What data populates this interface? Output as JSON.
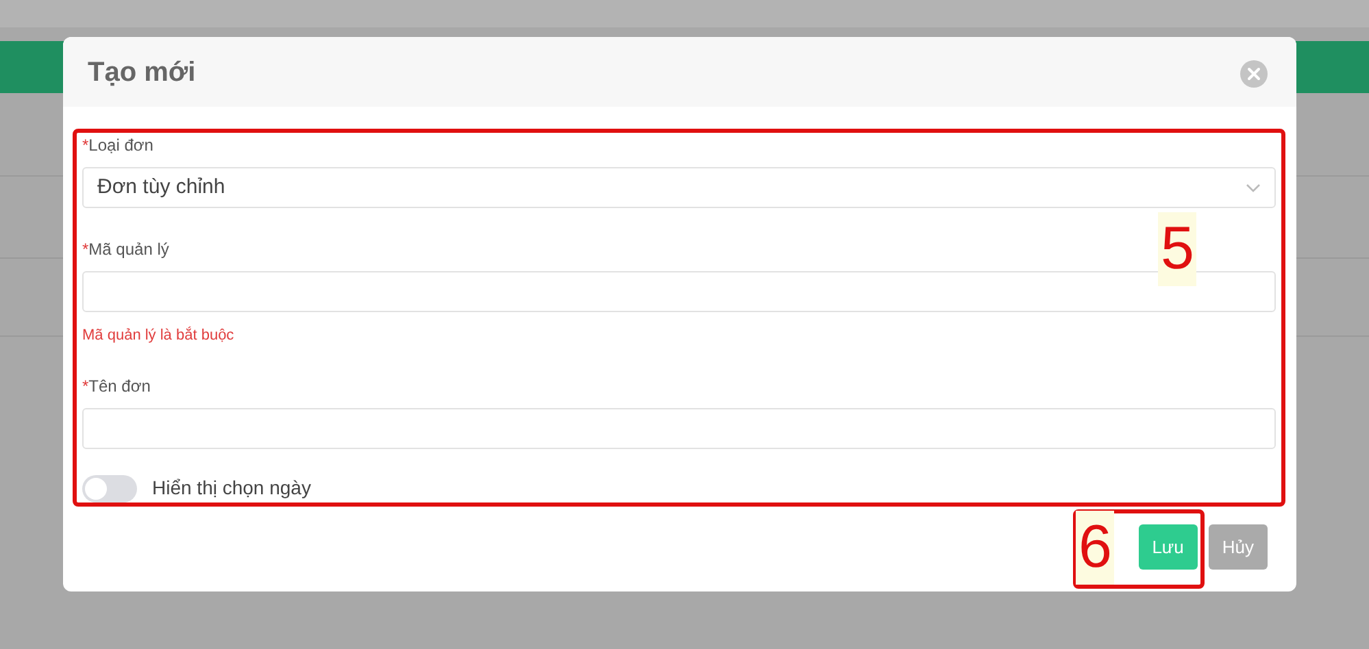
{
  "modal": {
    "title": "Tạo mới",
    "fields": [
      {
        "kind": "select",
        "marker": "*",
        "label": "Loại đơn",
        "value": "Đơn tùy chỉnh"
      },
      {
        "kind": "text",
        "marker": "*",
        "label": "Mã quản lý",
        "error": "Mã quản lý là bắt buộc"
      },
      {
        "kind": "text",
        "marker": "*",
        "label": "Tên đơn"
      },
      {
        "kind": "switch",
        "label": "Hiển thị chọn ngày",
        "on": false
      }
    ],
    "buttons": [
      {
        "label": "Lưu",
        "kind": "primary"
      },
      {
        "label": "Hủy",
        "kind": "secondary"
      }
    ]
  },
  "annotations": [
    {
      "label": "5"
    },
    {
      "label": "6"
    }
  ]
}
